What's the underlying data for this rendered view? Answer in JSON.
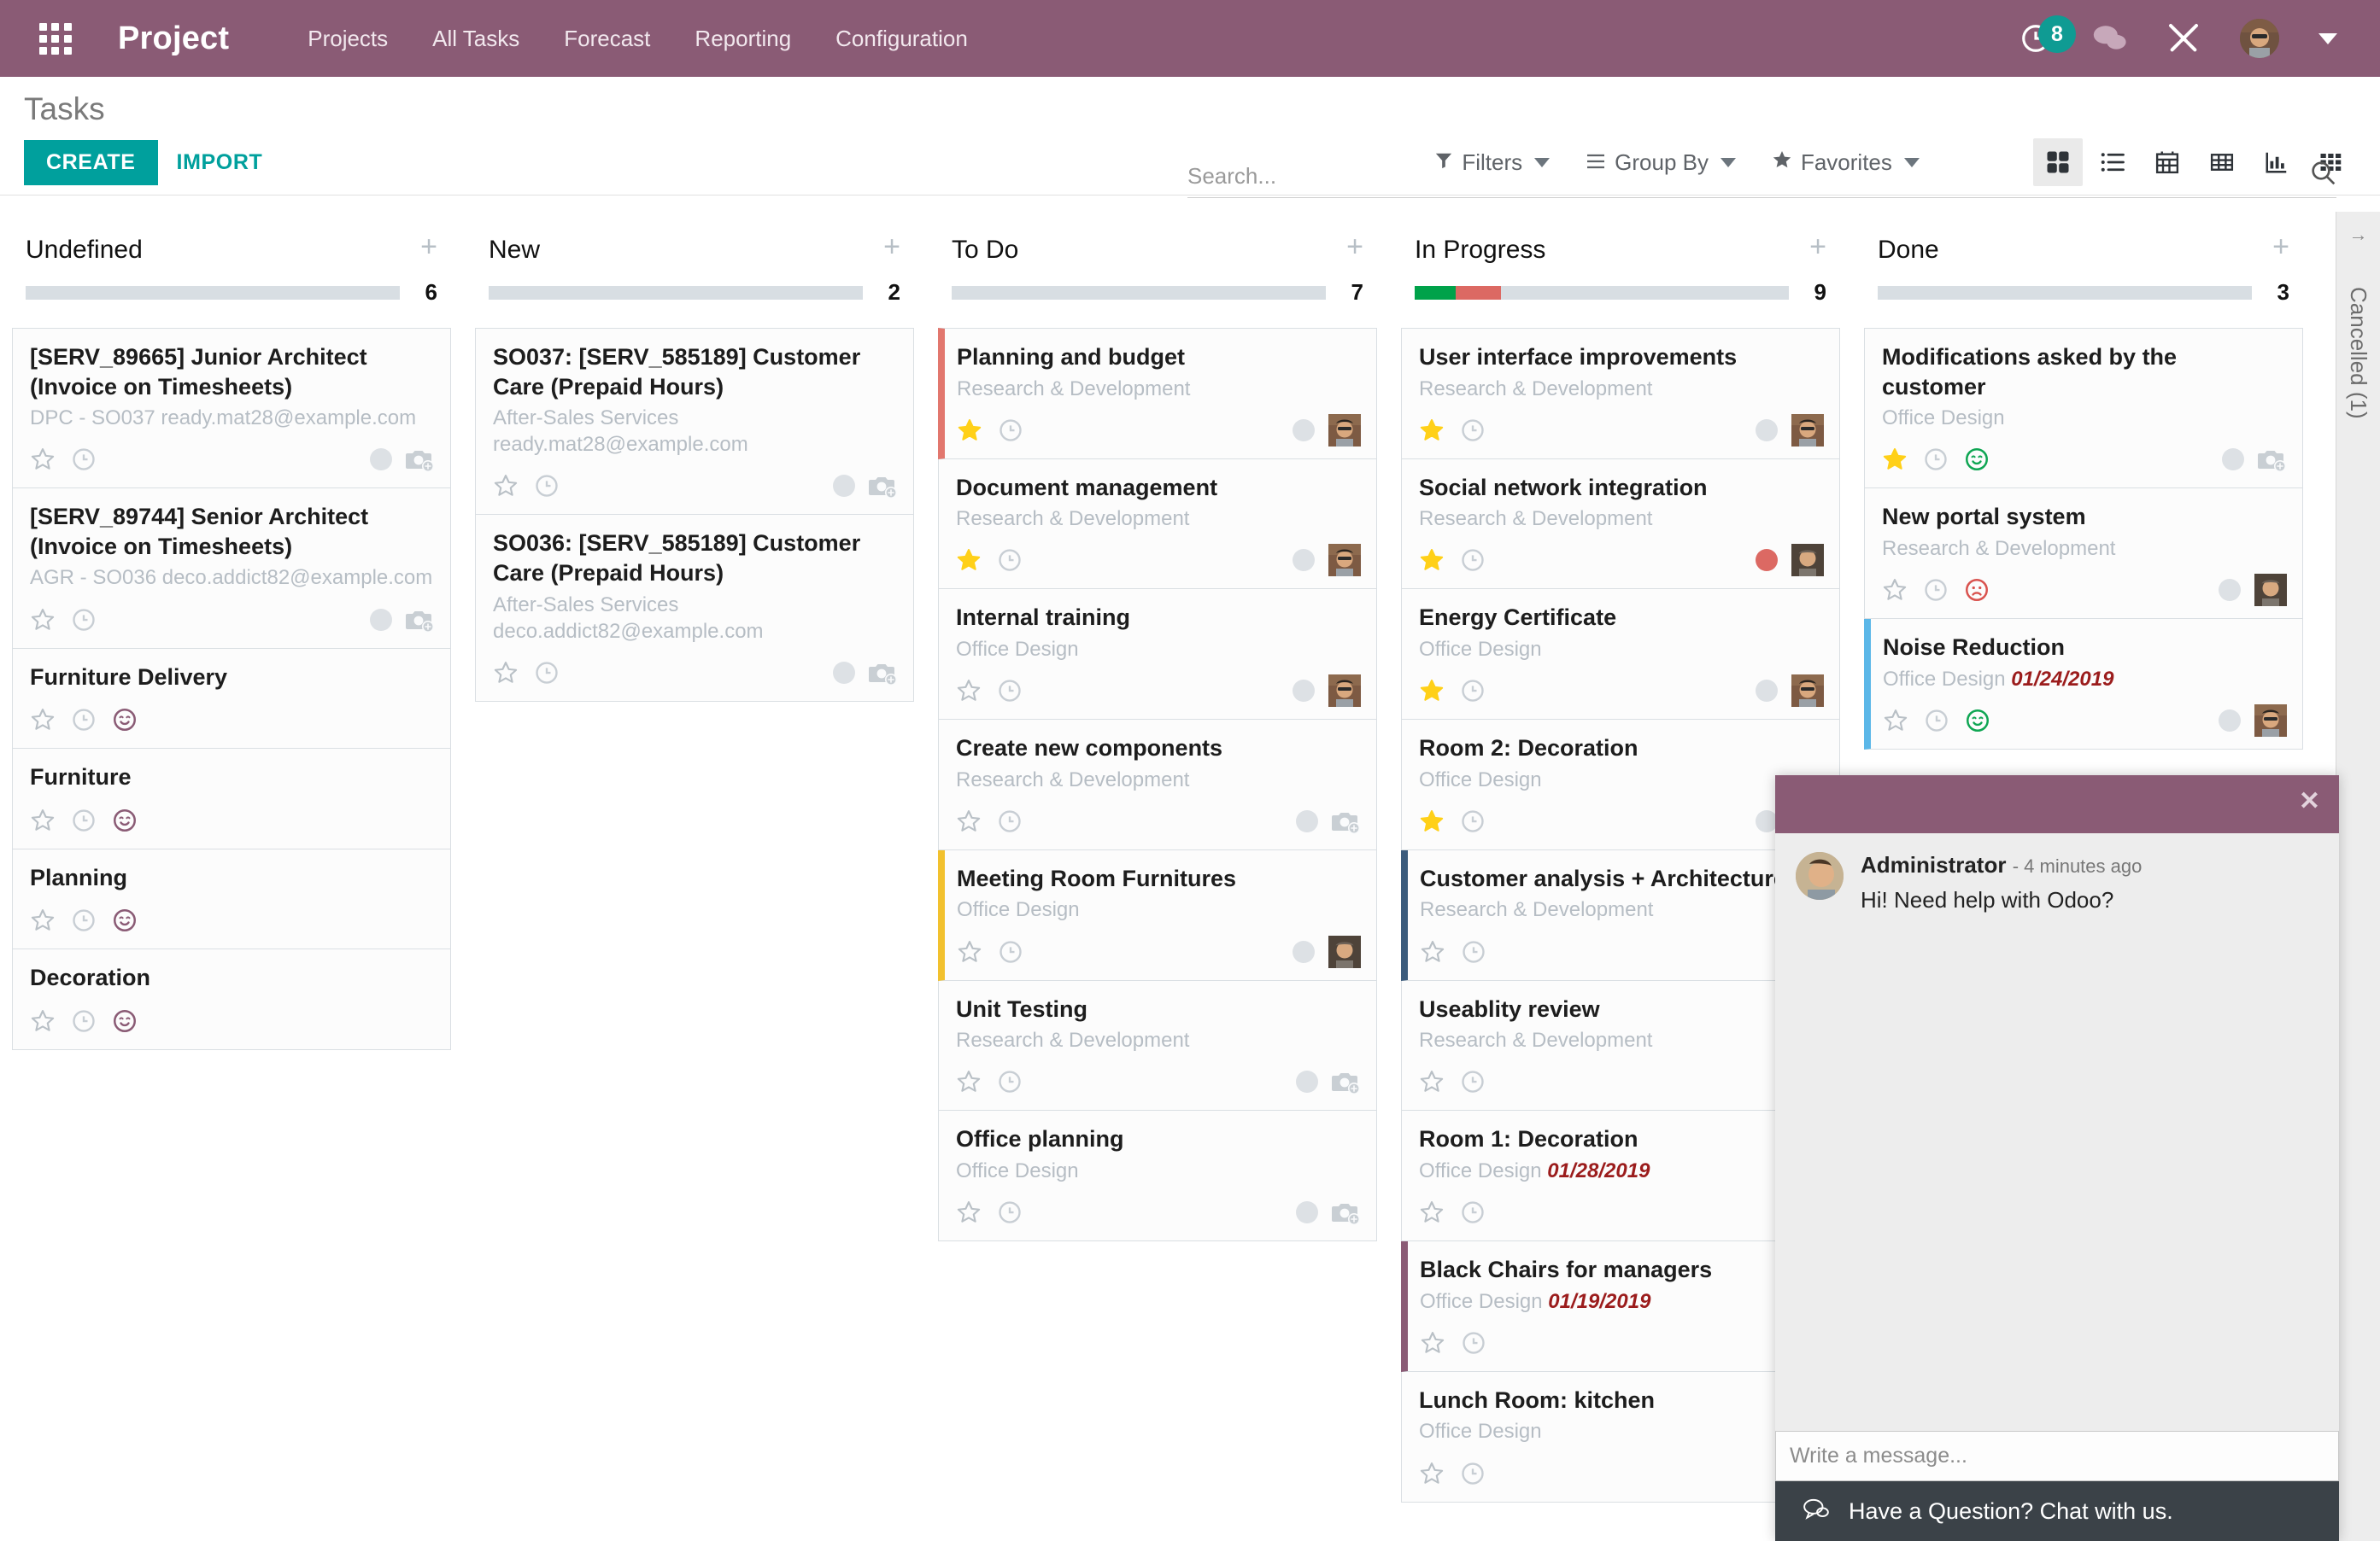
{
  "navbar": {
    "apps_icon": "apps-grid-icon",
    "brand": "Project",
    "links": [
      "Projects",
      "All Tasks",
      "Forecast",
      "Reporting",
      "Configuration"
    ],
    "activity_badge": "8",
    "icons": [
      "clock-icon",
      "messaging-icon",
      "tools-icon",
      "user-avatar",
      "chevron-down-icon"
    ]
  },
  "control_panel": {
    "title": "Tasks",
    "create_label": "CREATE",
    "import_label": "IMPORT",
    "search_placeholder": "Search...",
    "search_value": "",
    "filters_label": "Filters",
    "groupby_label": "Group By",
    "favorites_label": "Favorites",
    "views": [
      {
        "name": "kanban",
        "active": true
      },
      {
        "name": "list",
        "active": false
      },
      {
        "name": "calendar",
        "active": false
      },
      {
        "name": "pivot",
        "active": false
      },
      {
        "name": "graph",
        "active": false
      },
      {
        "name": "activity",
        "active": false
      }
    ]
  },
  "collapsed_column": {
    "label": "Cancelled (1)",
    "arrow": "→"
  },
  "columns": [
    {
      "title": "Undefined",
      "count": "6",
      "progress": [],
      "cards": [
        {
          "title": "[SERV_89665] Junior Architect (Invoice on Timesheets)",
          "sub": "DPC - SO037 ready.mat28@example.com",
          "date": "",
          "border": "",
          "star": false,
          "state": "",
          "dot": "gray",
          "avatar": "camera"
        },
        {
          "title": "[SERV_89744] Senior Architect (Invoice on Timesheets)",
          "sub": "AGR - SO036 deco.addict82@example.com",
          "date": "",
          "border": "",
          "star": false,
          "state": "",
          "dot": "gray",
          "avatar": "camera"
        },
        {
          "title": "Furniture Delivery",
          "sub": "",
          "date": "",
          "border": "",
          "star": false,
          "state": "ready",
          "dot": "",
          "avatar": ""
        },
        {
          "title": "Furniture",
          "sub": "",
          "date": "",
          "border": "",
          "star": false,
          "state": "ready",
          "dot": "",
          "avatar": ""
        },
        {
          "title": "Planning",
          "sub": "",
          "date": "",
          "border": "",
          "star": false,
          "state": "ready",
          "dot": "",
          "avatar": ""
        },
        {
          "title": "Decoration",
          "sub": "",
          "date": "",
          "border": "",
          "star": false,
          "state": "ready",
          "dot": "",
          "avatar": ""
        }
      ]
    },
    {
      "title": "New",
      "count": "2",
      "progress": [],
      "cards": [
        {
          "title": "SO037: [SERV_585189] Customer Care (Prepaid Hours)",
          "sub": "After-Sales Services ready.mat28@example.com",
          "date": "",
          "border": "",
          "star": false,
          "state": "",
          "dot": "gray",
          "avatar": "camera"
        },
        {
          "title": "SO036: [SERV_585189] Customer Care (Prepaid Hours)",
          "sub": "After-Sales Services deco.addict82@example.com",
          "date": "",
          "border": "",
          "star": false,
          "state": "",
          "dot": "gray",
          "avatar": "camera"
        }
      ]
    },
    {
      "title": "To Do",
      "count": "7",
      "progress": [],
      "cards": [
        {
          "title": "Planning and budget",
          "sub": "Research & Development",
          "date": "",
          "border": "#E2776E",
          "star": true,
          "state": "",
          "dot": "gray",
          "avatar": "photo1"
        },
        {
          "title": "Document management",
          "sub": "Research & Development",
          "date": "",
          "border": "",
          "star": true,
          "state": "",
          "dot": "gray",
          "avatar": "photo1"
        },
        {
          "title": "Internal training",
          "sub": "Office Design",
          "date": "",
          "border": "",
          "star": false,
          "state": "",
          "dot": "gray",
          "avatar": "photo1"
        },
        {
          "title": "Create new components",
          "sub": "Research & Development",
          "date": "",
          "border": "",
          "star": false,
          "state": "",
          "dot": "gray",
          "avatar": "camera"
        },
        {
          "title": "Meeting Room Furnitures",
          "sub": "Office Design",
          "date": "",
          "border": "#F2C12E",
          "star": false,
          "state": "",
          "dot": "gray",
          "avatar": "photo2"
        },
        {
          "title": "Unit Testing",
          "sub": "Research & Development",
          "date": "",
          "border": "",
          "star": false,
          "state": "",
          "dot": "gray",
          "avatar": "camera"
        },
        {
          "title": "Office planning",
          "sub": "Office Design",
          "date": "",
          "border": "",
          "star": false,
          "state": "",
          "dot": "gray",
          "avatar": "camera"
        }
      ]
    },
    {
      "title": "In Progress",
      "count": "9",
      "progress": [
        {
          "color": "#00A24A",
          "width": 11
        },
        {
          "color": "#DC6963",
          "width": 12
        }
      ],
      "cards": [
        {
          "title": "User interface improvements",
          "sub": "Research & Development",
          "date": "",
          "border": "",
          "star": true,
          "state": "",
          "dot": "gray",
          "avatar": "photo1"
        },
        {
          "title": "Social network integration",
          "sub": "Research & Development",
          "date": "",
          "border": "",
          "star": true,
          "state": "",
          "dot": "red",
          "avatar": "photo2"
        },
        {
          "title": "Energy Certificate",
          "sub": "Office Design",
          "date": "",
          "border": "",
          "star": true,
          "state": "",
          "dot": "gray",
          "avatar": "photo1"
        },
        {
          "title": "Room 2: Decoration",
          "sub": "Office Design",
          "date": "",
          "border": "",
          "star": true,
          "state": "",
          "dot": "gray",
          "avatar": "photo1"
        },
        {
          "title": "Customer analysis + Architecture",
          "sub": "Research & Development",
          "date": "",
          "border": "#3B5B7C",
          "star": false,
          "state": "",
          "dot": "gray",
          "avatar": ""
        },
        {
          "title": "Useablity review",
          "sub": "Research & Development",
          "date": "",
          "border": "",
          "star": false,
          "state": "",
          "dot": "",
          "avatar": ""
        },
        {
          "title": "Room 1: Decoration",
          "sub": "Office Design",
          "date": "01/28/2019",
          "border": "",
          "star": false,
          "state": "",
          "dot": "",
          "avatar": ""
        },
        {
          "title": "Black Chairs for managers",
          "sub": "Office Design",
          "date": "01/19/2019",
          "border": "#8A5B75",
          "star": false,
          "state": "",
          "dot": "",
          "avatar": ""
        },
        {
          "title": "Lunch Room: kitchen",
          "sub": "Office Design",
          "date": "",
          "border": "",
          "star": false,
          "state": "",
          "dot": "",
          "avatar": ""
        }
      ]
    },
    {
      "title": "Done",
      "count": "3",
      "progress": [],
      "cards": [
        {
          "title": "Modifications asked by the customer",
          "sub": "Office Design",
          "date": "",
          "border": "",
          "star": true,
          "state": "ready-green",
          "dot": "gray",
          "avatar": "camera"
        },
        {
          "title": "New portal system",
          "sub": "Research & Development",
          "date": "",
          "border": "",
          "star": false,
          "state": "blocked",
          "dot": "gray",
          "avatar": "photo2"
        },
        {
          "title": "Noise Reduction",
          "sub": "Office Design",
          "date": "01/24/2019",
          "border": "#5BB7E8",
          "star": false,
          "state": "ready-green",
          "dot": "gray",
          "avatar": "photo1"
        }
      ]
    }
  ],
  "livechat": {
    "close_label": "✕",
    "author": "Administrator",
    "timestamp": "- 4 minutes ago",
    "message": "Hi! Need help with Odoo?",
    "input_placeholder": "Write a message...",
    "bar_label": "Have a Question? Chat with us."
  }
}
